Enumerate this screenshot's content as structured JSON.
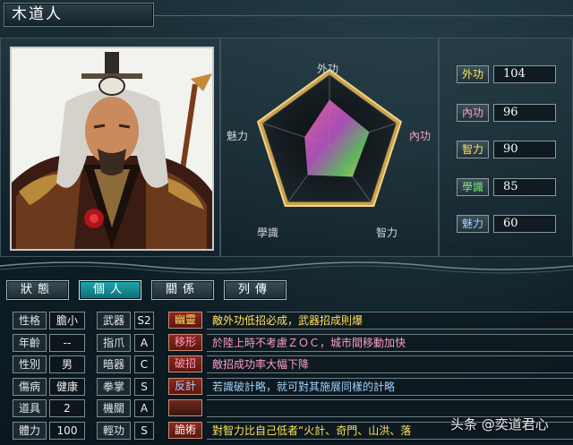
{
  "header": {
    "name": "木道人"
  },
  "radar": {
    "labels": {
      "top": "外功",
      "right": "內功",
      "bottom_right": "智力",
      "bottom_left": "學識",
      "left": "魅力"
    }
  },
  "stats": [
    {
      "label": "外功",
      "value": "104",
      "color": "#ffe35a"
    },
    {
      "label": "內功",
      "value": "96",
      "color": "#ff9dc8"
    },
    {
      "label": "智力",
      "value": "90",
      "color": "#ffe35a"
    },
    {
      "label": "學識",
      "value": "85",
      "color": "#7fe37f"
    },
    {
      "label": "魅力",
      "value": "60",
      "color": "#9fd0ff"
    }
  ],
  "tabs": [
    {
      "label": "狀態",
      "active": false
    },
    {
      "label": "個人",
      "active": true
    },
    {
      "label": "關係",
      "active": false
    },
    {
      "label": "列傳",
      "active": false
    }
  ],
  "attributes_left": [
    {
      "label": "性格",
      "value": "膽小"
    },
    {
      "label": "年齡",
      "value": "--"
    },
    {
      "label": "性別",
      "value": "男"
    },
    {
      "label": "傷病",
      "value": "健康"
    },
    {
      "label": "道具",
      "value": "2"
    },
    {
      "label": "體力",
      "value": "100"
    }
  ],
  "attributes_right": [
    {
      "label": "武器",
      "value": "S2"
    },
    {
      "label": "指爪",
      "value": "A"
    },
    {
      "label": "暗器",
      "value": "C"
    },
    {
      "label": "拳掌",
      "value": "S"
    },
    {
      "label": "機關",
      "value": "A"
    },
    {
      "label": "輕功",
      "value": "S"
    }
  ],
  "skills": [
    {
      "tag": "幽靈",
      "tag_color": "#ffe35a",
      "desc": "敵外功低招必成，武器招成則爆",
      "desc_color": "#ffe35a"
    },
    {
      "tag": "移形",
      "tag_color": "#ff9dc8",
      "desc": "於陸上時不考慮ＺＯＣ，城市間移動加快",
      "desc_color": "#ff9dc8"
    },
    {
      "tag": "破招",
      "tag_color": "#ff9dc8",
      "desc": "敵招成功率大幅下降",
      "desc_color": "#ff9dc8"
    },
    {
      "tag": "反計",
      "tag_color": "#9fd0ff",
      "desc": "若識破計略，就可對其施展同樣的計略",
      "desc_color": "#9fd0ff"
    },
    {
      "tag": "",
      "tag_color": "#ffffff",
      "desc": "",
      "desc_color": "#ffffff"
    },
    {
      "tag": "詭術",
      "tag_color": "#ffffff",
      "desc": "對智力比自己低者“火計、奇門、山洪、落",
      "desc_color": "#ffe35a"
    }
  ],
  "watermark": "头条 @奕道君心"
}
